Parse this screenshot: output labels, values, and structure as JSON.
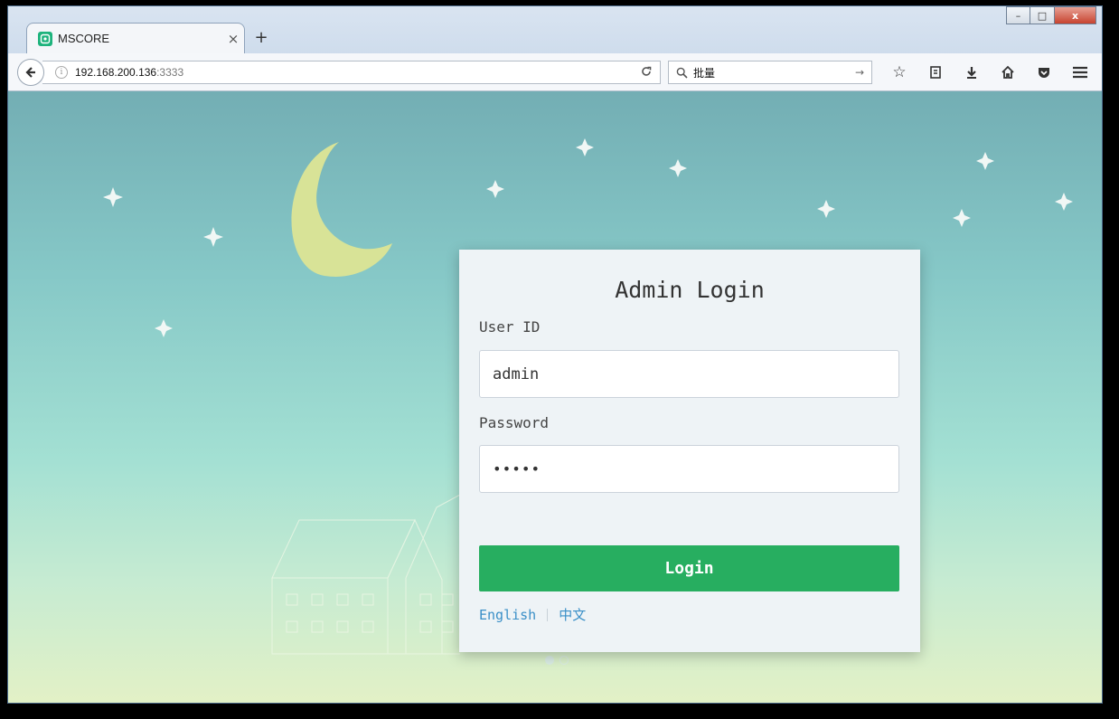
{
  "browser": {
    "tab_title": "MSCORE",
    "tab_close": "×",
    "new_tab": "+",
    "url_host": "192.168.200.136",
    "url_port": ":3333",
    "search_value": "批量",
    "window_controls": {
      "minimize": "–",
      "maximize": "□",
      "close": "x"
    },
    "toolbar_icons": [
      "star-icon",
      "reading-list-icon",
      "download-icon",
      "home-icon",
      "pocket-icon",
      "menu-icon"
    ]
  },
  "login": {
    "title": "Admin Login",
    "user_label": "User ID",
    "user_value": "admin",
    "password_label": "Password",
    "password_value": "•••••",
    "submit_label": "Login",
    "languages": [
      "English",
      "中文"
    ]
  },
  "colors": {
    "accent": "#27ae60",
    "link": "#3a8fc7",
    "moon": "#d8e397",
    "sky_top": "#73aeb4",
    "sky_bottom": "#e3f1c6"
  }
}
